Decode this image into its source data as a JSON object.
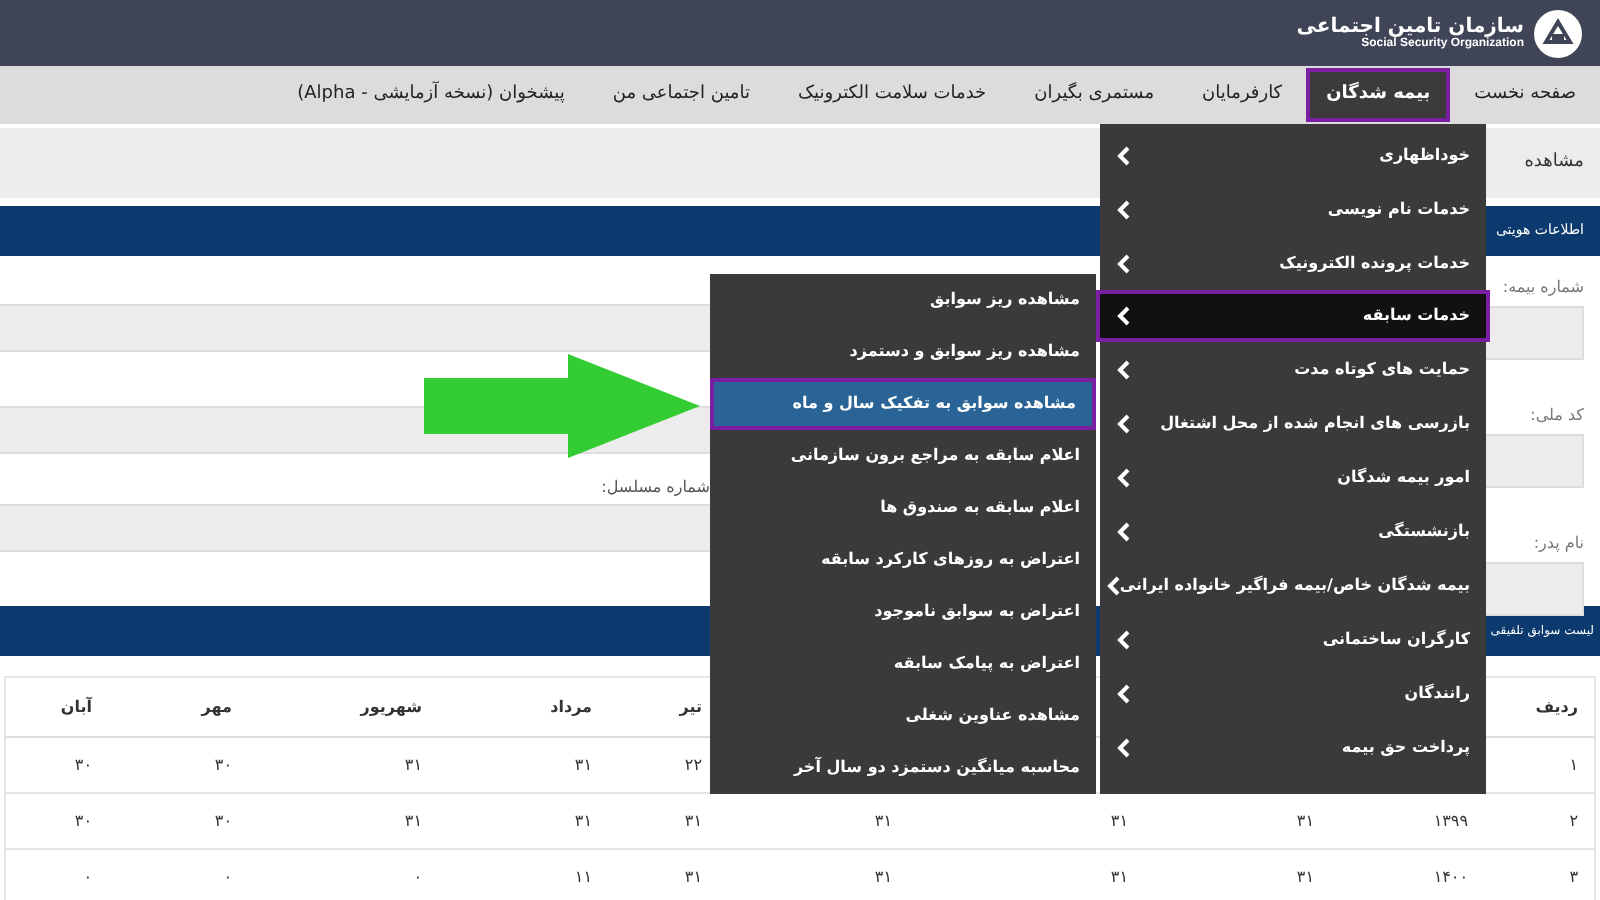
{
  "header": {
    "org_name": "سازمان تامین اجتماعی",
    "org_name_en": "Social Security Organization"
  },
  "nav": [
    {
      "label": "صفحه نخست",
      "selected": false
    },
    {
      "label": "بیمه شدگان",
      "selected": true
    },
    {
      "label": "کارفرمایان",
      "selected": false
    },
    {
      "label": "مستمری بگیران",
      "selected": false
    },
    {
      "label": "خدمات سلامت الکترونیک",
      "selected": false
    },
    {
      "label": "تامین اجتماعی من",
      "selected": false
    },
    {
      "label": "پیشخوان (نسخه آزمایشی - Alpha)",
      "selected": false
    }
  ],
  "breadcrumb": "مشاهده",
  "identity_section": {
    "title": "اطلاعات هویتی",
    "fields": [
      {
        "label": "شماره بیمه:"
      },
      {
        "label": "کد ملی:"
      },
      {
        "label": "نام پدر:"
      }
    ],
    "side_label": "شماره مسلسل:"
  },
  "records_section": {
    "title": "لیست سوابق تلفیقی"
  },
  "table": {
    "columns": [
      "ردیف",
      null,
      null,
      null,
      null,
      "تیر",
      "مرداد",
      "شهریور",
      "مهر",
      "آبان"
    ],
    "rows": [
      [
        "۱",
        null,
        null,
        null,
        null,
        "۲۲",
        "۳۱",
        "۳۱",
        "۳۰",
        "۳۰"
      ],
      [
        "۲",
        "۱۳۹۹",
        "۳۱",
        "۳۱",
        "۳۱",
        "۳۱",
        "۳۱",
        "۳۱",
        "۳۰",
        "۳۰"
      ],
      [
        "۳",
        "۱۴۰۰",
        "۳۱",
        "۳۱",
        "۳۱",
        "۳۱",
        "۱۱",
        "۰",
        "۰",
        "۰"
      ]
    ]
  },
  "menu": {
    "items": [
      {
        "label": "خوداظهاری",
        "selected": false
      },
      {
        "label": "خدمات نام نویسی",
        "selected": false
      },
      {
        "label": "خدمات پرونده الکترونیک",
        "selected": false
      },
      {
        "label": "خدمات سابقه",
        "selected": true
      },
      {
        "label": "حمایت های کوتاه مدت",
        "selected": false
      },
      {
        "label": "بازرسی های انجام شده از محل اشتغال",
        "selected": false
      },
      {
        "label": "امور بیمه شدگان",
        "selected": false
      },
      {
        "label": "بازنشستگی",
        "selected": false
      },
      {
        "label": "بیمه شدگان خاص/بیمه فراگیر خانواده ایرانی",
        "selected": false
      },
      {
        "label": "کارگران ساختمانی",
        "selected": false
      },
      {
        "label": "رانندگان",
        "selected": false
      },
      {
        "label": "پرداخت حق بیمه",
        "selected": false
      }
    ]
  },
  "submenu": {
    "items": [
      {
        "label": "مشاهده ریز سوابق",
        "selected": false
      },
      {
        "label": "مشاهده ریز سوابق و دستمزد",
        "selected": false
      },
      {
        "label": "مشاهده سوابق به تفکیک سال و ماه",
        "selected": true
      },
      {
        "label": "اعلام سابقه به مراجع برون سازمانی",
        "selected": false
      },
      {
        "label": "اعلام سابقه به صندوق ها",
        "selected": false
      },
      {
        "label": "اعتراض به روزهای کارکرد سابقه",
        "selected": false
      },
      {
        "label": "اعتراض به سوابق ناموجود",
        "selected": false
      },
      {
        "label": "اعتراض به پیامک سابقه",
        "selected": false
      },
      {
        "label": "مشاهده عناوین شغلی",
        "selected": false
      },
      {
        "label": "محاسبه میانگین دستمزد دو سال آخر",
        "selected": false
      }
    ]
  }
}
